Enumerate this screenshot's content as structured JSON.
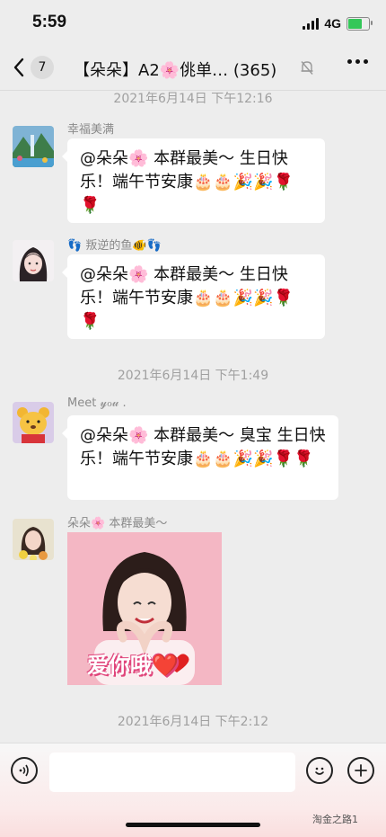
{
  "status_bar": {
    "time": "5:59",
    "network": "4G"
  },
  "header": {
    "back_count": "7",
    "title": "【朵朵】A2🌸佻单… (365)"
  },
  "timestamps": [
    "2021年6月14日 下午12:16",
    "2021年6月14日 下午1:49",
    "2021年6月14日 下午2:12"
  ],
  "messages": [
    {
      "sender": "幸福美满",
      "text": "@朵朵🌸 本群最美～ 生日快乐！端午节安康🎂🎂🎉🎉🌹🌹"
    },
    {
      "sender": "👣 叛逆的鱼🐠👣",
      "text": "@朵朵🌸 本群最美～ 生日快乐！端午节安康🎂🎂🎉🎉🌹🌹"
    },
    {
      "sender": "Meet 𝓎ℴ𝓊 .",
      "text": "@朵朵🌸 本群最美～ 臭宝 生日快乐！端午节安康🎂🎂🎉🎉🌹🌹"
    },
    {
      "sender": "朵朵🌸 本群最美～",
      "image_caption": "爱你哦❤️"
    }
  ],
  "watermark": "淘金之路1",
  "colors": {
    "background": "#ededed",
    "bubble": "#ffffff",
    "battery": "#34c759"
  }
}
